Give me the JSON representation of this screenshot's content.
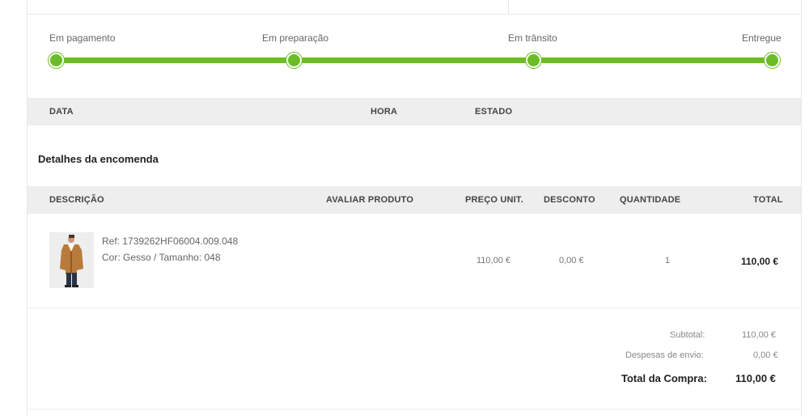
{
  "progress": {
    "steps": [
      {
        "label": "Em pagamento"
      },
      {
        "label": "Em preparação"
      },
      {
        "label": "Em trânsito"
      },
      {
        "label": "Entregue"
      }
    ],
    "accent_color": "#6cbd25"
  },
  "history_table": {
    "headers": {
      "date": "DATA",
      "time": "HORA",
      "status": "ESTADO"
    }
  },
  "order_details": {
    "title": "Detalhes da encomenda",
    "headers": {
      "description": "DESCRIÇÃO",
      "rate": "AVALIAR PRODUTO",
      "unit_price": "PREÇO UNIT.",
      "discount": "DESCONTO",
      "quantity": "QUANTIDADE",
      "total": "TOTAL"
    },
    "items": [
      {
        "ref": "Ref: 1739262HF06004.009.048",
        "variant": "Cor: Gesso / Tamanho: 048",
        "unit_price": "110,00 €",
        "discount": "0,00 €",
        "quantity": "1",
        "total": "110,00 €"
      }
    ]
  },
  "summary": {
    "subtotal_label": "Subtotal:",
    "subtotal_value": "110,00 €",
    "shipping_label": "Despesas de envio:",
    "shipping_value": "0,00 €",
    "total_label": "Total da Compra:",
    "total_value": "110,00 €"
  }
}
